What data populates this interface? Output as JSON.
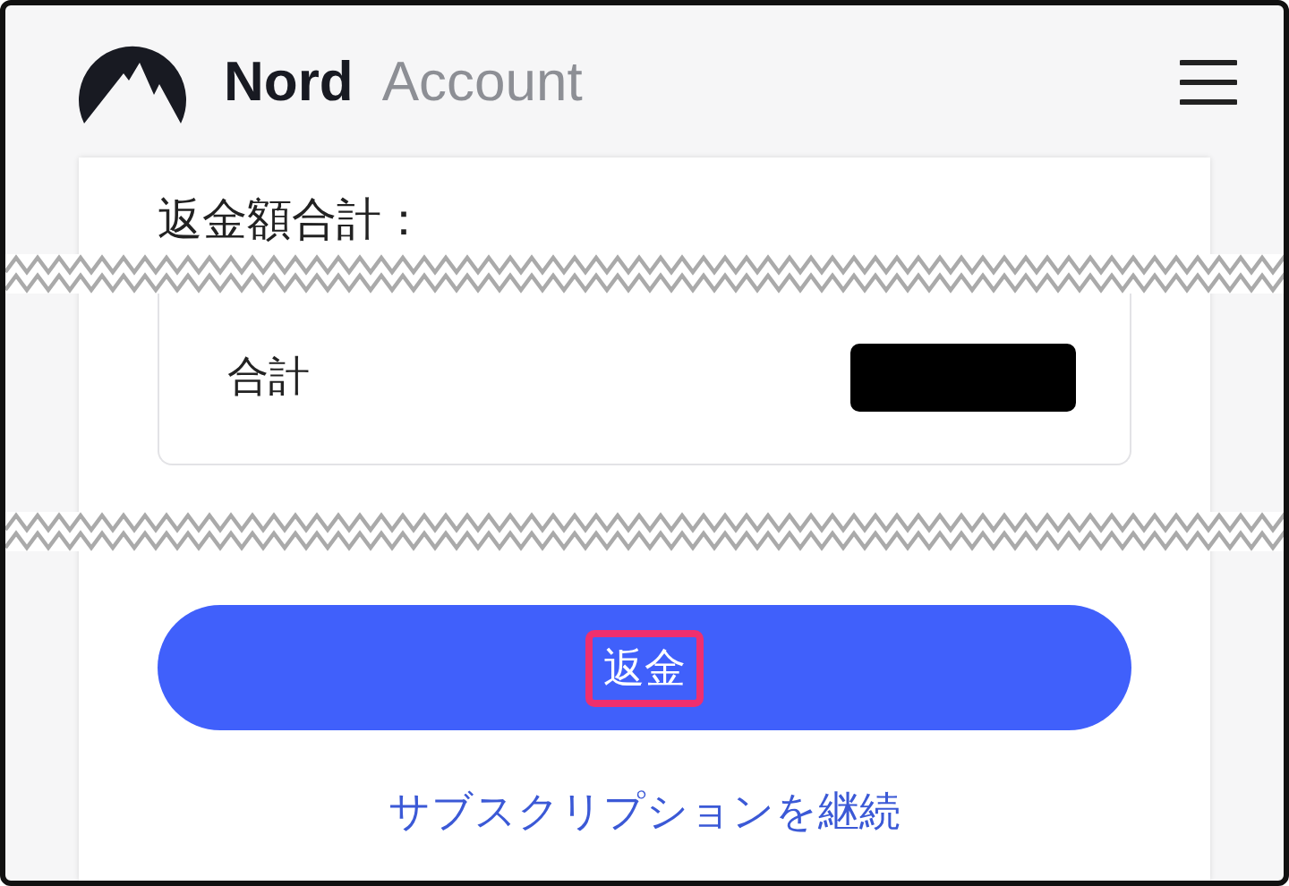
{
  "header": {
    "brand": "Nord",
    "product": "Account"
  },
  "refund_total": {
    "heading": "返金額合計：",
    "row_label": "合計",
    "value_redacted": true
  },
  "refund_button": {
    "label": "返金",
    "highlighted": true
  },
  "continue_link": "サブスクリプションを継続"
}
